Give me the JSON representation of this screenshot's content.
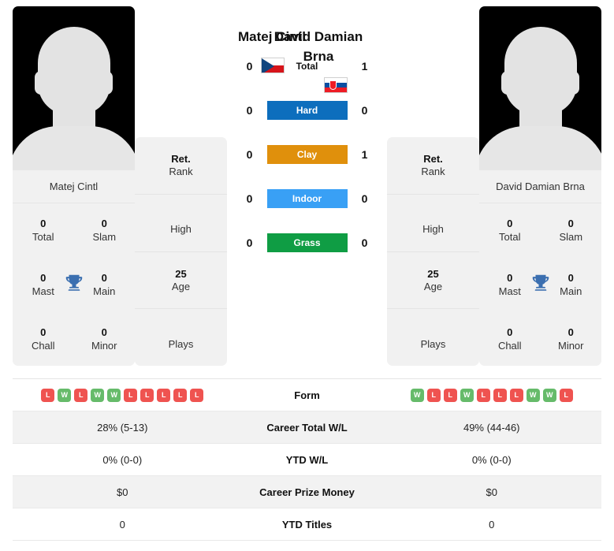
{
  "players": {
    "left": {
      "name": "Matej Cintl",
      "card_name": "Matej Cintl",
      "flag": "czech-republic-flag",
      "rank_value": "Ret.",
      "rank_label": "Rank",
      "high_value": "",
      "high_label": "High",
      "age_value": "25",
      "age_label": "Age",
      "plays_value": "",
      "plays_label": "Plays",
      "titles": [
        {
          "value": "0",
          "label": "Total"
        },
        {
          "value": "0",
          "label": "Slam"
        },
        {
          "value": "0",
          "label": "Mast"
        },
        {
          "value": "0",
          "label": "Main"
        },
        {
          "value": "0",
          "label": "Chall"
        },
        {
          "value": "0",
          "label": "Minor"
        }
      ],
      "form": [
        "L",
        "W",
        "L",
        "W",
        "W",
        "L",
        "L",
        "L",
        "L",
        "L"
      ],
      "career_total_wl": "28% (5-13)",
      "ytd_wl": "0% (0-0)",
      "career_prize_money": "$0",
      "ytd_titles": "0"
    },
    "right": {
      "name": "David Damian Brna",
      "card_name": "David Damian Brna",
      "flag": "slovakia-flag",
      "rank_value": "Ret.",
      "rank_label": "Rank",
      "high_value": "",
      "high_label": "High",
      "age_value": "25",
      "age_label": "Age",
      "plays_value": "",
      "plays_label": "Plays",
      "titles": [
        {
          "value": "0",
          "label": "Total"
        },
        {
          "value": "0",
          "label": "Slam"
        },
        {
          "value": "0",
          "label": "Mast"
        },
        {
          "value": "0",
          "label": "Main"
        },
        {
          "value": "0",
          "label": "Chall"
        },
        {
          "value": "0",
          "label": "Minor"
        }
      ],
      "form": [
        "W",
        "L",
        "L",
        "W",
        "L",
        "L",
        "L",
        "W",
        "W",
        "L"
      ],
      "career_total_wl": "49% (44-46)",
      "ytd_wl": "0% (0-0)",
      "career_prize_money": "$0",
      "ytd_titles": "0"
    }
  },
  "surfaces": [
    {
      "label": "Total",
      "left": "0",
      "right": "1",
      "color": "transparent",
      "plain": true
    },
    {
      "label": "Hard",
      "left": "0",
      "right": "0",
      "color": "#0d6ebd",
      "plain": false
    },
    {
      "label": "Clay",
      "left": "0",
      "right": "1",
      "color": "#e0900c",
      "plain": false
    },
    {
      "label": "Indoor",
      "left": "0",
      "right": "0",
      "color": "#39a0f5",
      "plain": false
    },
    {
      "label": "Grass",
      "left": "0",
      "right": "0",
      "color": "#0f9d44",
      "plain": false
    }
  ],
  "table": {
    "form_label": "Form",
    "career_total_wl_label": "Career Total W/L",
    "ytd_wl_label": "YTD W/L",
    "career_prize_money_label": "Career Prize Money",
    "ytd_titles_label": "YTD Titles"
  },
  "colors": {
    "win": "#66bb6a",
    "loss": "#ef5350",
    "trophy": "#3b6fb0",
    "card_bg": "#f1f1f1"
  }
}
